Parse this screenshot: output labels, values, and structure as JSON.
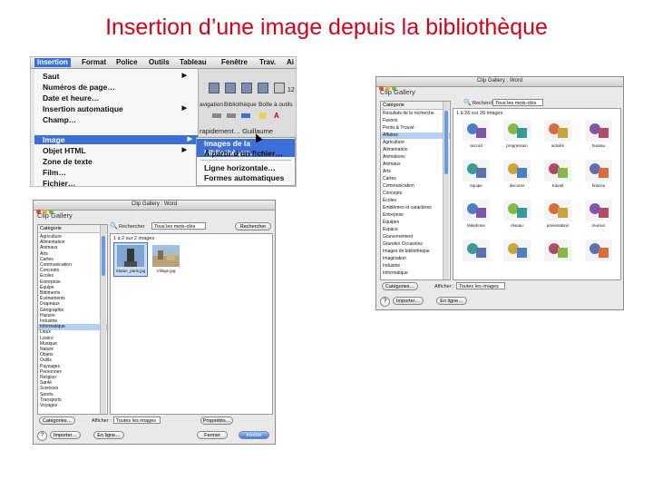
{
  "slide": {
    "title": "Insertion d’une image depuis la bibliothèque"
  },
  "menu_screenshot": {
    "menubar": [
      "Insertion",
      "Format",
      "Police",
      "Outils",
      "Tableau",
      "Fenêtre",
      "Trav.",
      "Ai"
    ],
    "menu_items": [
      {
        "label": "Saut",
        "submenu": true
      },
      {
        "label": "Numéros de page…",
        "submenu": false
      },
      {
        "label": "Date et heure…",
        "submenu": false
      },
      {
        "label": "Insertion automatique",
        "submenu": true
      },
      {
        "label": "Champ…",
        "submenu": false
      },
      {
        "label": "Image",
        "submenu": true,
        "selected": true
      },
      {
        "label": "Objet HTML",
        "submenu": true
      },
      {
        "label": "Zone de texte",
        "submenu": false
      },
      {
        "label": "Film…",
        "submenu": false
      },
      {
        "label": "Fichier…",
        "submenu": false
      }
    ],
    "background_labels": [
      "avigation",
      "Bibliothèque",
      "Boîte à outils",
      "rapidement… Guillaume"
    ],
    "submenu_items": [
      {
        "label": "Images de la bibliothèque…",
        "selected": true
      },
      {
        "label": "À partir d’un fichier…",
        "selected": false
      },
      {
        "label": "Ligne horizontale…",
        "selected": false
      },
      {
        "label": "Formes automatiques",
        "selected": false
      }
    ],
    "zoom_fragment": "12"
  },
  "gallery_small": {
    "window_title": "Clip Gallery : Word",
    "subtitle": "Clip Gallery",
    "search_label": "Rechercher",
    "search_dropdown": "Tous les mots-clés",
    "search_button": "Rechercher",
    "category_header": "Catégorie",
    "categories": [
      "Agriculture",
      "Alimentation",
      "Animaux",
      "Arts",
      "Cartes",
      "Communication",
      "Concepts",
      "Écoles",
      "Entreprise",
      "Équipe",
      "Bâtiments",
      "Événements",
      "Drapeaux",
      "Géographie",
      "Histoire",
      "Industrie",
      "Informatique",
      "Lieux",
      "Loisirs",
      "Musique",
      "Nature",
      "Objets",
      "Outils",
      "Paysages",
      "Personnes",
      "Religion",
      "Santé",
      "Sciences",
      "Sports",
      "Transports",
      "Voyages"
    ],
    "selected_category_index": 16,
    "grid_caption": "1 à 2 sur 2 images",
    "thumbs": [
      {
        "caption": "Statue_paris.jpg",
        "selected": true
      },
      {
        "caption": "Village.jpg",
        "selected": false
      }
    ],
    "footer": {
      "categories_button": "Catégories…",
      "show_label": "Afficher :",
      "show_dropdown": "Toutes les images",
      "properties_button": "Propriétés…",
      "import_button": "Importer…",
      "online_button": "En ligne…",
      "close_button": "Fermer",
      "insert_button": "Insérer"
    }
  },
  "gallery_large": {
    "window_title": "Clip Gallery : Word",
    "subtitle": "Clip Gallery",
    "search_label": "Rechercher",
    "search_dropdown": "Tous les mots-clés",
    "category_header": "Catégorie",
    "categories": [
      "Résultats de la recherche",
      "Favoris",
      "Perdu & Trouvé",
      "Affaires",
      "Agriculture",
      "Alimentation",
      "Animations",
      "Animaux",
      "Arts",
      "Cartes",
      "Communication",
      "Concepts",
      "Écoles",
      "Emblèmes et caractères",
      "Entreprise",
      "Équipes",
      "Espace",
      "Gouvernement",
      "Grandes Occasions",
      "Images de bibliothèque",
      "Imagination",
      "Industrie",
      "Informatique"
    ],
    "selected_category_index": 3,
    "grid_caption": "1 à 26 sur 26 images",
    "thumbs": [
      {
        "caption": "accord",
        "selected": false
      },
      {
        "caption": "progression",
        "selected": false
      },
      {
        "caption": "activité",
        "selected": false
      },
      {
        "caption": "bureau",
        "selected": false
      },
      {
        "caption": "équipe",
        "selected": false
      },
      {
        "caption": "discours",
        "selected": false
      },
      {
        "caption": "travail",
        "selected": false
      },
      {
        "caption": "finance",
        "selected": false
      },
      {
        "caption": "téléphone",
        "selected": false
      },
      {
        "caption": "réseau",
        "selected": false
      },
      {
        "caption": "présentation",
        "selected": false
      },
      {
        "caption": "réunion",
        "selected": false
      },
      {
        "caption": "",
        "selected": false
      },
      {
        "caption": "",
        "selected": false
      },
      {
        "caption": "",
        "selected": false
      },
      {
        "caption": "",
        "selected": false
      }
    ],
    "footer": {
      "categories_button": "Catégories…",
      "show_label": "Afficher :",
      "show_dropdown": "Toutes les images",
      "import_button": "Importer…",
      "online_button": "En ligne…"
    }
  }
}
